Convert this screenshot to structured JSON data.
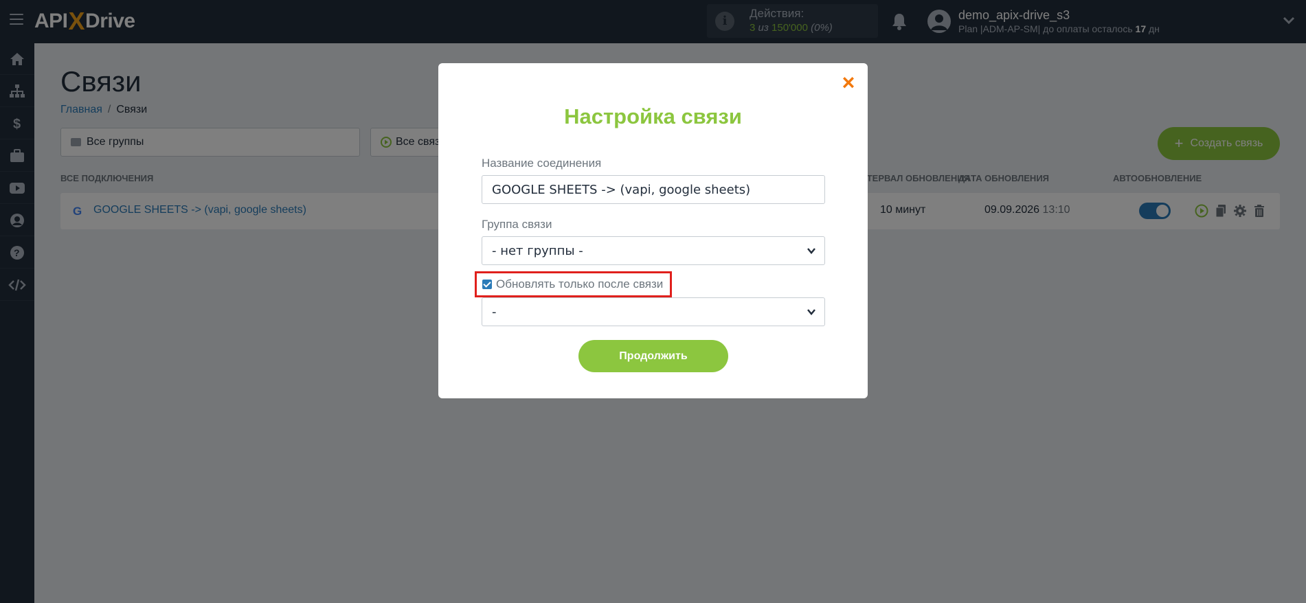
{
  "header": {
    "logo": {
      "prefix": "API",
      "x": "X",
      "suffix": "Drive"
    },
    "actions": {
      "title": "Действия:",
      "used": "3",
      "of_text": "из",
      "total": "150'000",
      "percent": "(0%)"
    },
    "user": {
      "name": "demo_apix-drive_s3",
      "plan_prefix": "Plan |ADM-AP-SM| до оплаты осталось",
      "days": "17",
      "days_unit": "дн"
    }
  },
  "sidebar": {
    "items": [
      {
        "icon": "home-icon"
      },
      {
        "icon": "sitemap-icon"
      },
      {
        "icon": "dollar-icon"
      },
      {
        "icon": "briefcase-icon"
      },
      {
        "icon": "youtube-icon"
      },
      {
        "icon": "user-circle-icon"
      },
      {
        "icon": "help-icon"
      },
      {
        "icon": "code-icon"
      }
    ]
  },
  "page": {
    "title": "Связи",
    "breadcrumb": {
      "home": "Главная",
      "current": "Связи"
    },
    "group_select": "Все группы",
    "status_select": "Все связи",
    "create_button": "Создать связь",
    "table": {
      "headers": {
        "all": "ВСЕ ПОДКЛЮЧЕНИЯ",
        "interval": "ИНТЕРВАЛ ОБНОВЛЕНИЯ",
        "date": "ДАТА ОБНОВЛЕНИЯ",
        "auto": "АВТООБНОВЛЕНИЕ"
      },
      "rows": [
        {
          "name": "GOOGLE SHEETS -> (vapi, google sheets)",
          "interval": "10 минут",
          "date": "09.09.2026",
          "time": "13:10",
          "auto_update": true
        }
      ]
    }
  },
  "modal": {
    "title": "Настройка связи",
    "name_label": "Название соединения",
    "name_value": "GOOGLE SHEETS -> (vapi, google sheets)",
    "group_label": "Группа связи",
    "group_value": "- нет группы -",
    "checkbox_label": "Обновлять только после связи",
    "checkbox_checked": true,
    "after_select_value": "-",
    "continue_button": "Продолжить"
  },
  "colors": {
    "brand_green": "#8cc63f",
    "brand_orange": "#f2a31b",
    "close_orange": "#f2780c",
    "link_blue": "#2b7bb8",
    "header_dark": "#232e3c",
    "highlight_red": "#e0201c"
  }
}
